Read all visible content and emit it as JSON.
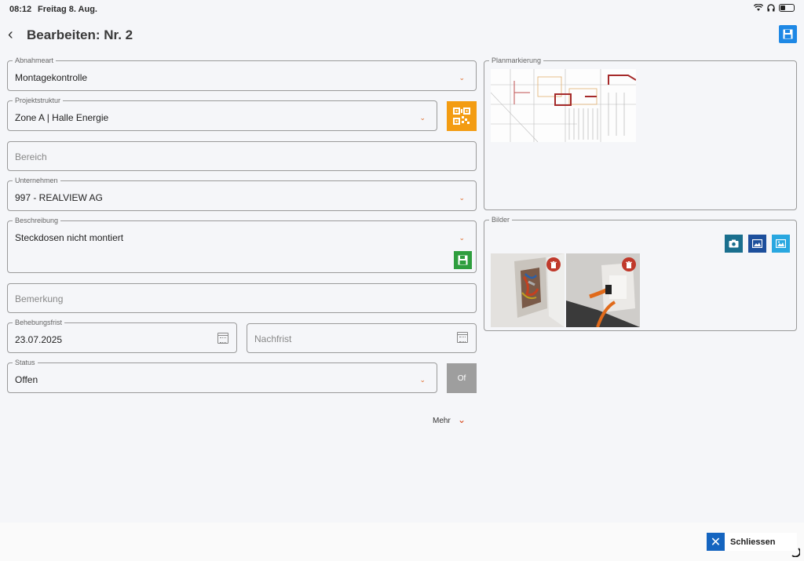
{
  "statusbar": {
    "time": "08:12",
    "date": "Freitag 8. Aug."
  },
  "header": {
    "title": "Bearbeiten: Nr. 2"
  },
  "form": {
    "abnahmeart": {
      "label": "Abnahmeart",
      "value": "Montagekontrolle"
    },
    "projektstruktur": {
      "label": "Projektstruktur",
      "value": "Zone A | Halle Energie"
    },
    "bereich": {
      "placeholder": "Bereich"
    },
    "unternehmen": {
      "label": "Unternehmen",
      "value": "997 - REALVIEW AG"
    },
    "beschreibung": {
      "label": "Beschreibung",
      "value": "Steckdosen nicht montiert"
    },
    "bemerkung": {
      "placeholder": "Bemerkung"
    },
    "behebungsfrist": {
      "label": "Behebungsfrist",
      "value": "23.07.2025"
    },
    "nachfrist": {
      "placeholder": "Nachfrist"
    },
    "status": {
      "label": "Status",
      "value": "Offen",
      "badge": "Of"
    },
    "mehr": "Mehr"
  },
  "panels": {
    "plan_title": "Planmarkierung",
    "bilder_title": "Bilder"
  },
  "footer": {
    "close_label": "Schliessen"
  },
  "colors": {
    "accent_orange": "#f39c12",
    "save_blue": "#1e88e5",
    "save_green": "#2e9e3e",
    "delete_red": "#c0392b",
    "status_gray": "#9e9e9e"
  }
}
